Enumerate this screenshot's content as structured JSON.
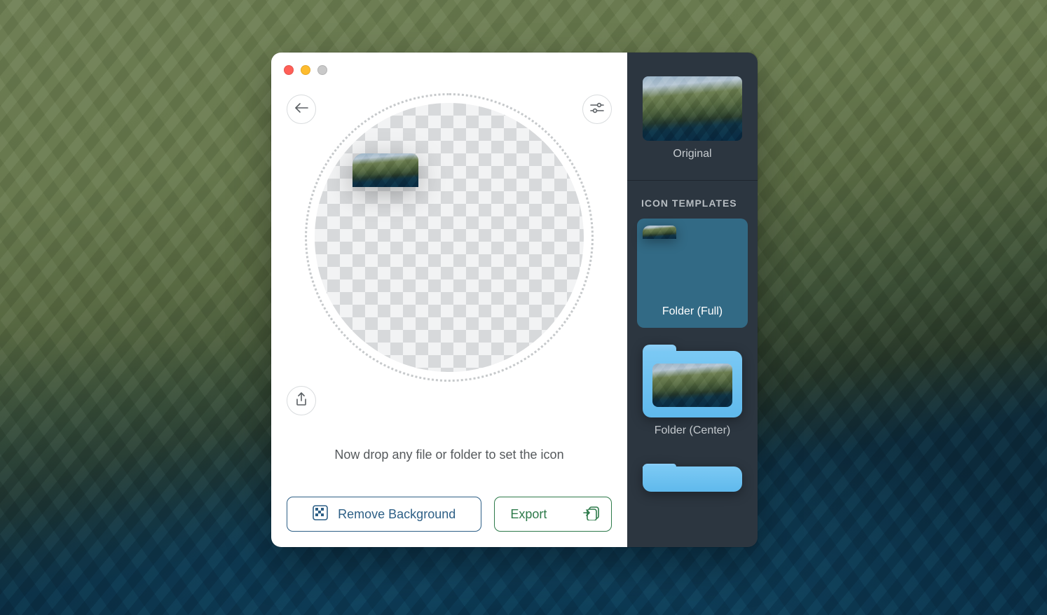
{
  "main": {
    "instruction": "Now drop any file or folder to set the icon",
    "buttons": {
      "remove_bg_label": "Remove Background",
      "export_label": "Export"
    }
  },
  "sidebar": {
    "original_label": "Original",
    "section_header": "ICON TEMPLATES",
    "templates": [
      {
        "label": "Folder (Full)",
        "selected": true
      },
      {
        "label": "Folder (Center)",
        "selected": false
      }
    ]
  },
  "colors": {
    "remove_bg": "#2d5f86",
    "export": "#2d7a4a",
    "sidebar_bg": "#2c3640",
    "selected_bg": "#326a85"
  }
}
